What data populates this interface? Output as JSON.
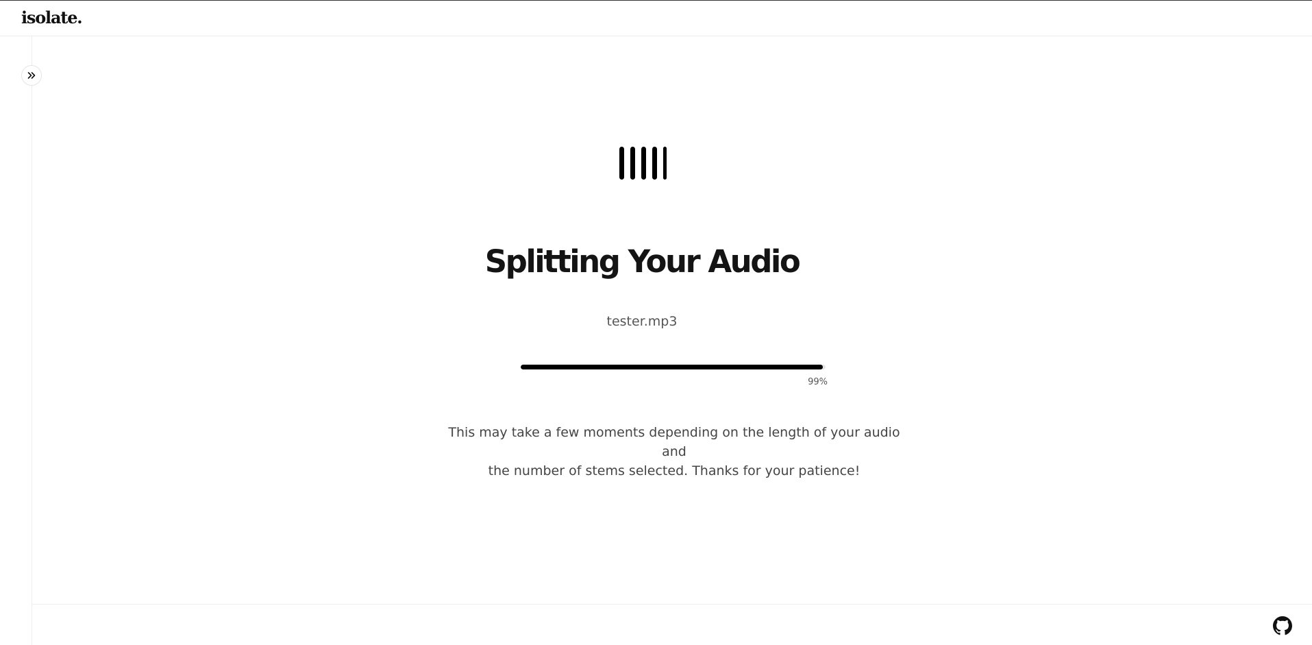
{
  "app": {
    "logo_text": "isolate."
  },
  "sidebar": {
    "toggle_icon": "chevrons-right-icon"
  },
  "processing": {
    "icon": "audio-stems-icon",
    "title": "Splitting Your Audio",
    "filename": "tester.mp3",
    "progress": {
      "value": 99,
      "label": "99%"
    },
    "message_line1": "This may take a few moments depending on the length of your audio and",
    "message_line2": "the number of stems selected. Thanks for your patience!"
  },
  "footer": {
    "github_icon": "github-icon"
  },
  "colors": {
    "accent": "#000000",
    "text_primary": "#141414",
    "text_secondary": "#555555",
    "border": "#ededed",
    "track": "#e6e6e6"
  }
}
